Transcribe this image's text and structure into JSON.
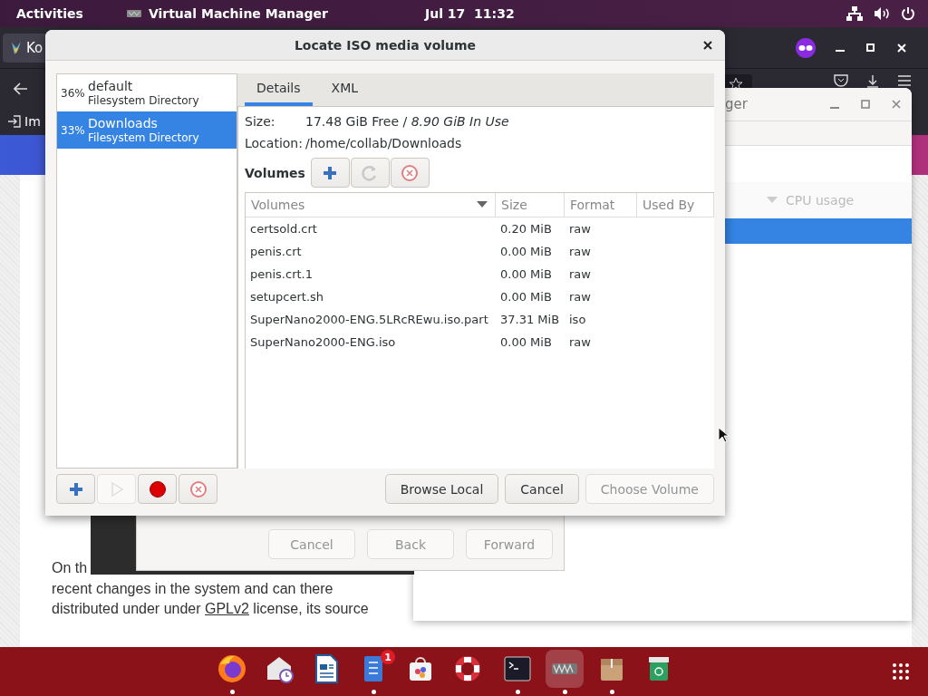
{
  "top_bar": {
    "activities": "Activities",
    "app_name": "Virtual Machine Manager",
    "clock": "Jul 17  11:32"
  },
  "browser": {
    "tab_title": "Ko",
    "bookmark": "Im"
  },
  "page": {
    "lines": [
      "On th",
      "recent changes in the system and can there"
    ],
    "before": "distributed under under ",
    "link": "GPLv2",
    "after": " license, its source"
  },
  "manager_window": {
    "title": "ger",
    "column": "CPU usage",
    "rows": [
      {
        "selected": true
      }
    ]
  },
  "wizard": {
    "buttons": [
      {
        "label": "Cancel",
        "disabled": true
      },
      {
        "label": "Back",
        "disabled": true
      },
      {
        "label": "Forward",
        "disabled": true
      }
    ]
  },
  "dialog": {
    "title": "Locate ISO media volume",
    "pools": [
      {
        "usage": "36%",
        "name": "default",
        "type": "Filesystem Directory",
        "selected": false
      },
      {
        "usage": "33%",
        "name": "Downloads",
        "type": "Filesystem Directory",
        "selected": true
      }
    ],
    "pool_tools": [
      {
        "kind": "add",
        "disabled": false
      },
      {
        "kind": "start",
        "disabled": true
      },
      {
        "kind": "stop",
        "disabled": false
      },
      {
        "kind": "delete",
        "disabled": false
      }
    ],
    "tabs": [
      {
        "label": "Details",
        "selected": true
      },
      {
        "label": "XML",
        "selected": false
      }
    ],
    "size_label": "Size:",
    "size_value": "17.48 GiB Free / *8.90 GiB In Use*",
    "location_label": "Location:",
    "location_value": "/home/collab/Downloads",
    "volumes_label": "Volumes",
    "volume_tools": [
      {
        "kind": "add"
      },
      {
        "kind": "refresh"
      },
      {
        "kind": "delete"
      }
    ],
    "columns": [
      {
        "label": "Volumes",
        "sorted": true
      },
      {
        "label": "Size",
        "sorted": false
      },
      {
        "label": "Format",
        "sorted": false
      },
      {
        "label": "Used By",
        "sorted": false
      }
    ],
    "rows": [
      {
        "name": "certsold.crt",
        "size": "0.20 MiB",
        "format": "raw"
      },
      {
        "name": "penis.crt",
        "size": "0.00 MiB",
        "format": "raw"
      },
      {
        "name": "penis.crt.1",
        "size": "0.00 MiB",
        "format": "raw"
      },
      {
        "name": "setupcert.sh",
        "size": "0.00 MiB",
        "format": "raw"
      },
      {
        "name": "SuperNano2000-ENG.5LRcREwu.iso.part",
        "size": "37.31 MiB",
        "format": "iso"
      },
      {
        "name": "SuperNano2000-ENG.iso",
        "size": "0.00 MiB",
        "format": "raw"
      }
    ],
    "buttons": [
      {
        "label": "Browse Local",
        "disabled": false
      },
      {
        "label": "Cancel",
        "disabled": false
      },
      {
        "label": "Choose Volume",
        "disabled": true
      }
    ]
  },
  "taskbar": {
    "apps": [
      {
        "kind": "firefox",
        "running": true,
        "active": false
      },
      {
        "kind": "mail",
        "running": false,
        "active": false
      },
      {
        "kind": "writer",
        "running": false,
        "active": false
      },
      {
        "kind": "notes",
        "running": true,
        "active": false,
        "badge": "1"
      },
      {
        "kind": "store",
        "running": false,
        "active": false
      },
      {
        "kind": "help",
        "running": false,
        "active": false
      },
      {
        "kind": "terminal",
        "running": true,
        "active": false
      },
      {
        "kind": "vmm",
        "running": true,
        "active": true
      },
      {
        "kind": "archive",
        "running": true,
        "active": false
      },
      {
        "kind": "trash",
        "running": false,
        "active": false
      }
    ]
  }
}
